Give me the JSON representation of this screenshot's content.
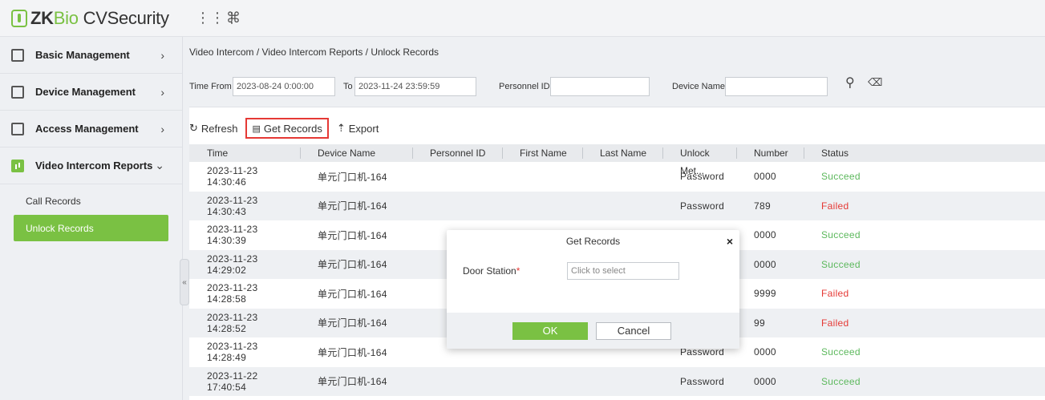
{
  "header": {
    "logo_zk": "ZK",
    "logo_bio": "Bio",
    "logo_product": "CVSecurity",
    "grid_icon": "⋮⋮⋮",
    "cmd_icon": "⌘"
  },
  "sidebar": {
    "items": [
      {
        "label": "Basic Management",
        "chevron": "›"
      },
      {
        "label": "Device Management",
        "chevron": "›"
      },
      {
        "label": "Access Management",
        "chevron": "›"
      },
      {
        "label": "Video Intercom Reports",
        "chevron": "⌄"
      }
    ],
    "sub_items": [
      {
        "label": "Call Records"
      },
      {
        "label": "Unlock Records"
      }
    ],
    "collapse": "«"
  },
  "breadcrumb": "Video Intercom / Video Intercom Reports / Unlock Records",
  "filters": {
    "time_from_label": "Time From",
    "time_from_value": "2023-08-24 0:00:00",
    "to_label": "To",
    "to_value": "2023-11-24 23:59:59",
    "personnel_id_label": "Personnel ID",
    "personnel_id_value": "",
    "device_name_label": "Device Name",
    "device_name_value": "",
    "search_icon": "⚲",
    "clear_icon": "⌫"
  },
  "toolbar": {
    "refresh": "Refresh",
    "get_records": "Get Records",
    "export": "Export"
  },
  "table": {
    "columns": [
      "Time",
      "Device Name",
      "Personnel ID",
      "First Name",
      "Last Name",
      "Unlock Met...",
      "Number",
      "Status"
    ],
    "rows": [
      {
        "time": "2023-11-23 14:30:46",
        "device": "单元门口机-164",
        "pid": "",
        "first": "",
        "last": "",
        "method": "Password",
        "number": "0000",
        "status": "Succeed"
      },
      {
        "time": "2023-11-23 14:30:43",
        "device": "单元门口机-164",
        "pid": "",
        "first": "",
        "last": "",
        "method": "Password",
        "number": "789",
        "status": "Failed"
      },
      {
        "time": "2023-11-23 14:30:39",
        "device": "单元门口机-164",
        "pid": "",
        "first": "",
        "last": "",
        "method": "",
        "number": "0000",
        "status": "Succeed"
      },
      {
        "time": "2023-11-23 14:29:02",
        "device": "单元门口机-164",
        "pid": "",
        "first": "",
        "last": "",
        "method": "",
        "number": "0000",
        "status": "Succeed"
      },
      {
        "time": "2023-11-23 14:28:58",
        "device": "单元门口机-164",
        "pid": "",
        "first": "",
        "last": "",
        "method": "",
        "number": "9999",
        "status": "Failed"
      },
      {
        "time": "2023-11-23 14:28:52",
        "device": "单元门口机-164",
        "pid": "",
        "first": "",
        "last": "",
        "method": "",
        "number": "99",
        "status": "Failed"
      },
      {
        "time": "2023-11-23 14:28:49",
        "device": "单元门口机-164",
        "pid": "",
        "first": "",
        "last": "",
        "method": "Password",
        "number": "0000",
        "status": "Succeed"
      },
      {
        "time": "2023-11-22 17:40:54",
        "device": "单元门口机-164",
        "pid": "",
        "first": "",
        "last": "",
        "method": "Password",
        "number": "0000",
        "status": "Succeed"
      }
    ]
  },
  "dialog": {
    "title": "Get Records",
    "close": "×",
    "door_station_label": "Door Station",
    "required_mark": "*",
    "door_station_placeholder": "Click to select",
    "ok": "OK",
    "cancel": "Cancel"
  },
  "colors": {
    "accent_green": "#7ac143",
    "succeed": "#5cb85c",
    "failed": "#e53935",
    "highlight_border": "#e53935"
  }
}
